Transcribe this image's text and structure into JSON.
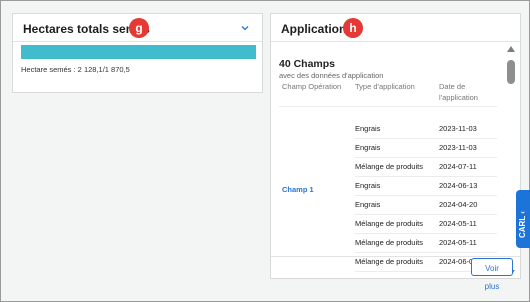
{
  "left_panel": {
    "title": "Hectares totals semés",
    "marker": "g",
    "progress_fraction": 1.0,
    "progress_text": "Hectare semés : 2 128,1/1 870,5"
  },
  "right_panel": {
    "title": "Applications",
    "marker": "h",
    "summary_title": "40 Champs",
    "summary_subtitle": "avec des données d'application",
    "columns": [
      "Champ Opération",
      "Type d'application",
      "Date de l'application"
    ],
    "champ": "Champ 1",
    "rows": [
      {
        "type": "Engrais",
        "date": "2023-11-03"
      },
      {
        "type": "Engrais",
        "date": "2023-11-03"
      },
      {
        "type": "Mélange de produits",
        "date": "2024-07-11"
      },
      {
        "type": "Engrais",
        "date": "2024-06-13"
      },
      {
        "type": "Engrais",
        "date": "2024-04-20"
      },
      {
        "type": "Mélange de produits",
        "date": "2024-05-11"
      },
      {
        "type": "Mélange de produits",
        "date": "2024-05-11"
      },
      {
        "type": "Mélange de produits",
        "date": "2024-06-07"
      }
    ],
    "voir_plus": "Voir plus"
  },
  "carl_tab": {
    "label": "CARL ‹"
  },
  "icons": {
    "collapse": "chevron-down-icon",
    "scroll_up": "scroll-up-arrow",
    "scroll_down": "scroll-down-arrow"
  },
  "colors": {
    "progress": "#40bccc",
    "link": "#2a74d4",
    "marker": "#e53935",
    "carl": "#1c73d8"
  }
}
